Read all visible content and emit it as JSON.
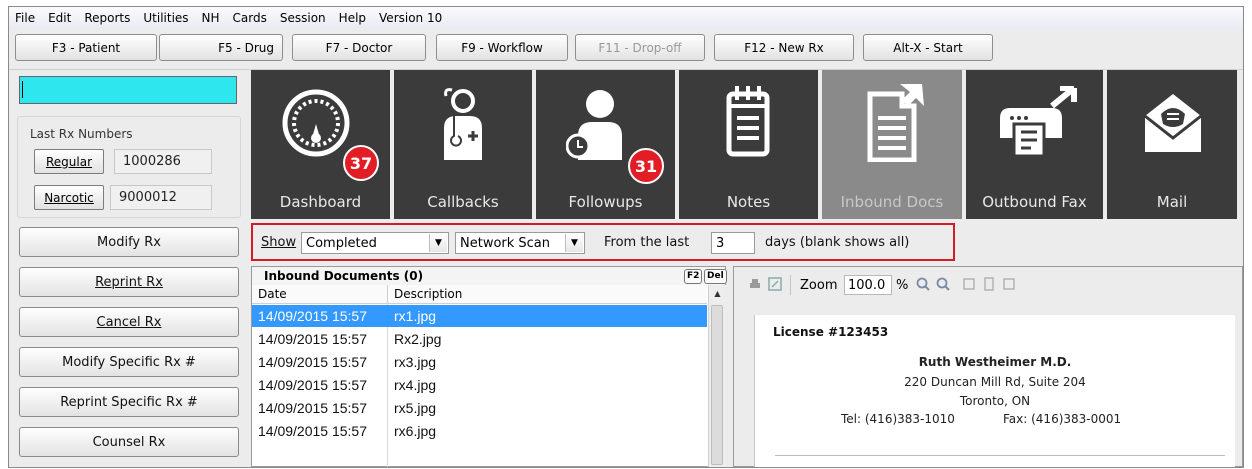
{
  "menu": [
    "File",
    "Edit",
    "Reports",
    "Utilities",
    "NH",
    "Cards",
    "Session",
    "Help",
    "Version 10"
  ],
  "toolbar": {
    "patient": {
      "key": "F3",
      "label": "Patient",
      "text": "F3 - Patient"
    },
    "drug": "F5 - Drug",
    "doctor": "F7 - Doctor",
    "workflow": "F9 - Workflow",
    "dropoff": "F11 - Drop-off",
    "newrx": "F12 - New Rx",
    "start": "Alt-X - Start"
  },
  "left": {
    "last_rx_title": "Last Rx Numbers",
    "regular_label": "Regular",
    "regular_value": "1000286",
    "narcotic_label": "Narcotic",
    "narcotic_value": "9000012",
    "actions": [
      "Modify Rx",
      "Reprint Rx",
      "Cancel Rx",
      "Modify Specific Rx #",
      "Reprint Specific Rx #",
      "Counsel Rx"
    ]
  },
  "tiles": [
    {
      "label": "Dashboard",
      "icon": "dashboard-gauge-icon",
      "badge": "37"
    },
    {
      "label": "Callbacks",
      "icon": "doctor-icon"
    },
    {
      "label": "Followups",
      "icon": "followup-person-alarm-icon",
      "badge": "31"
    },
    {
      "label": "Notes",
      "icon": "notepad-icon"
    },
    {
      "label": "Inbound Docs",
      "icon": "inbound-document-icon"
    },
    {
      "label": "Outbound Fax",
      "icon": "fax-icon"
    },
    {
      "label": "Mail",
      "icon": "mail-envelope-icon"
    }
  ],
  "filter": {
    "show_label": "Show",
    "status_value": "Completed",
    "source_value": "Network Scan",
    "from_label": "From the last",
    "days_value": "3",
    "days_suffix": "days (blank shows all)"
  },
  "docs": {
    "title": "Inbound Documents (0)",
    "key_f2": "F2",
    "key_del": "Del",
    "columns": [
      "Date",
      "Description"
    ],
    "rows": [
      {
        "date": "14/09/2015 15:57",
        "desc": "rx1.jpg"
      },
      {
        "date": "14/09/2015 15:57",
        "desc": "Rx2.jpg"
      },
      {
        "date": "14/09/2015 15:57",
        "desc": "rx3.jpg"
      },
      {
        "date": "14/09/2015 15:57",
        "desc": "rx4.jpg"
      },
      {
        "date": "14/09/2015 15:57",
        "desc": "rx5.jpg"
      },
      {
        "date": "14/09/2015 15:57",
        "desc": "rx6.jpg"
      }
    ]
  },
  "viewer": {
    "zoom_label": "Zoom",
    "zoom_value": "100.0",
    "zoom_unit": "%",
    "license": "License #123453",
    "doctor": "Ruth Westheimer M.D.",
    "address": "220 Duncan Mill Rd, Suite 204",
    "city": "Toronto, ON",
    "tel": "Tel: (416)383-1010",
    "fax": "Fax: (416)383-0001"
  },
  "colors": {
    "accent_cyan": "#2ee6ee",
    "tile_dark": "#3b3b3b",
    "tile_selected": "#8a8a8a",
    "badge_red": "#e21d25",
    "highlight_box": "#d01d26",
    "selected_row": "#3399ff"
  }
}
